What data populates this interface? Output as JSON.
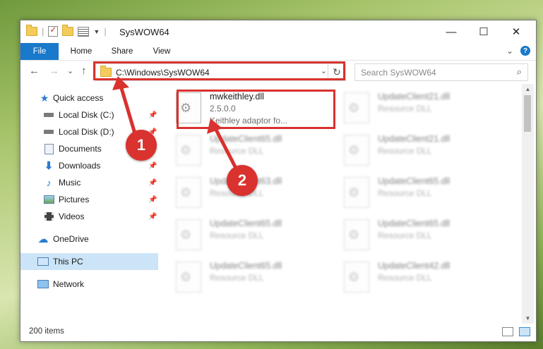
{
  "window": {
    "title": "SysWOW64",
    "minimize": "—",
    "maximize": "☐",
    "close": "✕"
  },
  "ribbon": {
    "tabs": [
      "File",
      "Home",
      "Share",
      "View"
    ],
    "expand": "⌄",
    "help": "?"
  },
  "nav": {
    "back": "←",
    "forward": "→",
    "recent": "⌄",
    "up": "↑",
    "address": "C:\\Windows\\SysWOW64",
    "address_dropdown": "⌄",
    "refresh": "↻",
    "search_placeholder": "Search SysWOW64",
    "search_icon": "search-icon"
  },
  "sidebar": {
    "items": [
      {
        "label": "Quick access",
        "icon": "star-icon"
      },
      {
        "label": "Local Disk (C:)",
        "icon": "drive-icon"
      },
      {
        "label": "Local Disk (D:)",
        "icon": "drive-icon"
      },
      {
        "label": "Documents",
        "icon": "documents-icon"
      },
      {
        "label": "Downloads",
        "icon": "download-icon"
      },
      {
        "label": "Music",
        "icon": "music-icon"
      },
      {
        "label": "Pictures",
        "icon": "pictures-icon"
      },
      {
        "label": "Videos",
        "icon": "videos-icon"
      },
      {
        "label": "OneDrive",
        "icon": "cloud-icon"
      },
      {
        "label": "This PC",
        "icon": "computer-icon"
      },
      {
        "label": "Network",
        "icon": "network-icon"
      }
    ],
    "selected": "This PC"
  },
  "files": [
    {
      "name": "mwkeithley.dll",
      "version": "2.5.0.0",
      "description": "Keithley adaptor fo..."
    },
    {
      "name": "UpdateClient21.dll",
      "type": "Resource DLL"
    },
    {
      "name": "UpdateClient65.dll",
      "type": "Resource DLL"
    },
    {
      "name": "UpdateClient21.dll",
      "type": "Resource DLL"
    },
    {
      "name": "UpdateClient63.dll",
      "type": "Resource DLL"
    },
    {
      "name": "UpdateClient65.dll",
      "type": "Resource DLL"
    },
    {
      "name": "UpdateClient65.dll",
      "type": "Resource DLL"
    },
    {
      "name": "UpdateClient65.dll",
      "type": "Resource DLL"
    },
    {
      "name": "UpdateClient65.dll",
      "type": "Resource DLL"
    },
    {
      "name": "UpdateClient42.dll",
      "type": "Resource DLL"
    }
  ],
  "status": {
    "count": "200 items"
  },
  "callouts": [
    "1",
    "2"
  ],
  "colors": {
    "accent": "#1979ca",
    "highlight": "#d9322f",
    "selected": "#cce4f7"
  }
}
